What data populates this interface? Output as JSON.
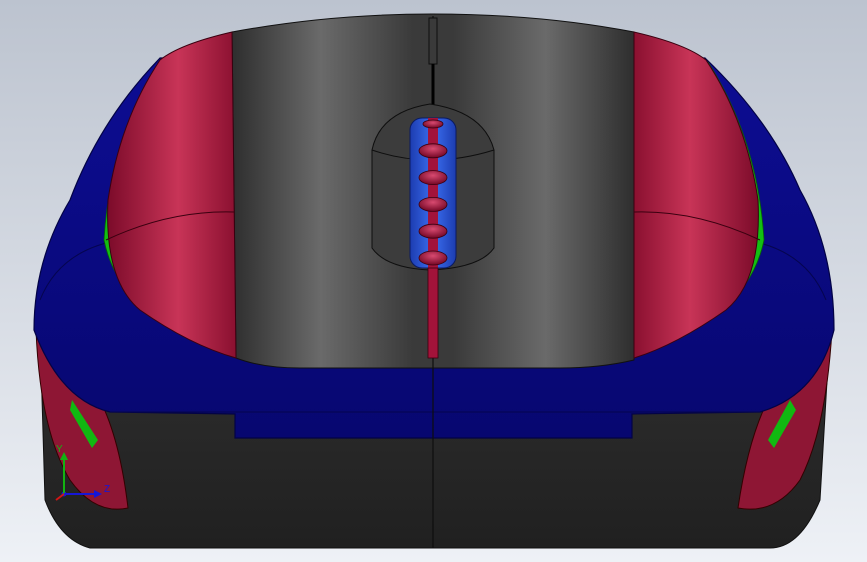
{
  "viewport": {
    "background_top": "#bcc3cf",
    "background_bottom": "#eef1f6"
  },
  "model": {
    "colors": {
      "body_dark": "#2b2b2b",
      "shell_gray": "#4a4a4a",
      "blue_trim": "#0a0a86",
      "red_button": "#b0173f",
      "green_seam": "#0bbf0b",
      "wheel_blue": "#2452d6",
      "wheel_red": "#a3133a"
    },
    "wheel_rib_count": 6
  },
  "triad": {
    "x_label": "Z",
    "y_label": "Y",
    "x_color": "#1616d8",
    "y_color": "#12b312",
    "z_color": "#d01616"
  }
}
